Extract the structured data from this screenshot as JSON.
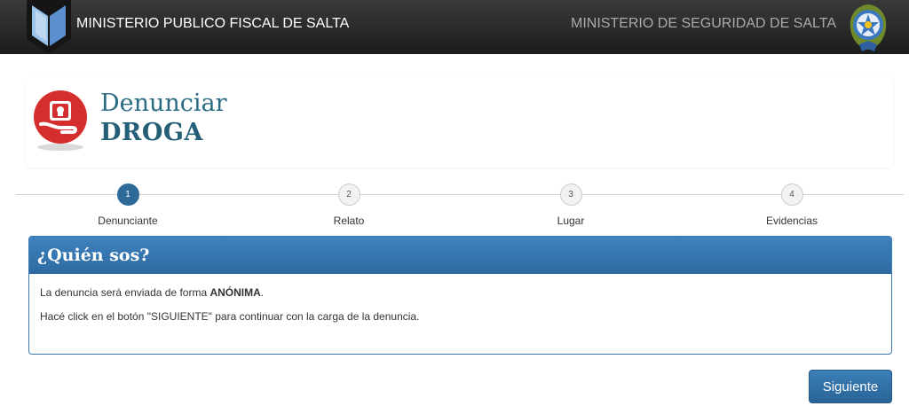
{
  "navbar": {
    "left_title": "MINISTERIO PUBLICO FISCAL DE SALTA",
    "right_title": "MINISTERIO DE SEGURIDAD DE SALTA"
  },
  "header": {
    "title_line1": "Denunciar",
    "title_line2": "DROGA"
  },
  "stepper": {
    "steps": [
      {
        "number": "1",
        "label": "Denunciante",
        "active": true
      },
      {
        "number": "2",
        "label": "Relato",
        "active": false
      },
      {
        "number": "3",
        "label": "Lugar",
        "active": false
      },
      {
        "number": "4",
        "label": "Evidencias",
        "active": false
      }
    ]
  },
  "panel": {
    "title": "¿Quién sos?",
    "line1_prefix": "La denuncia será enviada de forma ",
    "line1_bold": "ANÓNIMA",
    "line1_suffix": ".",
    "line2": "Hacé click en el botón \"SIGUIENTE\" para continuar con la carga de la denuncia."
  },
  "actions": {
    "next_label": "Siguiente"
  },
  "colors": {
    "navbar_bg": "#2a2a2a",
    "accent_blue": "#2e6a97",
    "title_teal": "#2a6b84",
    "badge_red": "#d32f2f"
  }
}
